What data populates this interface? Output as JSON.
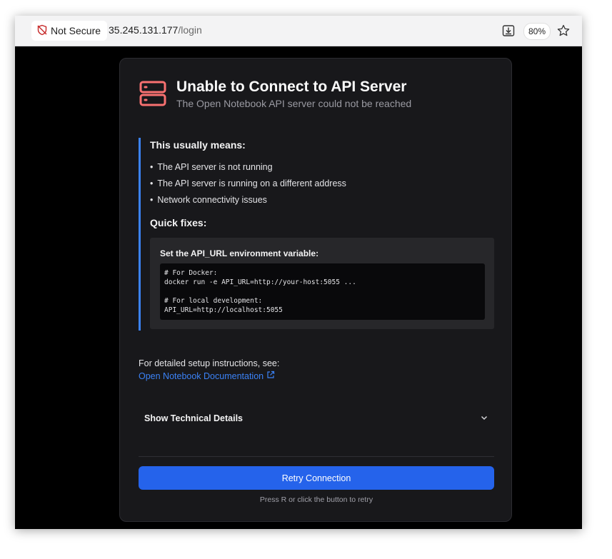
{
  "browser": {
    "security_label": "Not Secure",
    "url_host": "35.245.131.177",
    "url_path": "/login",
    "zoom": "80%"
  },
  "card": {
    "title": "Unable to Connect to API Server",
    "subtitle": "The Open Notebook API server could not be reached",
    "means_heading": "This usually means:",
    "means_items": [
      "The API server is not running",
      "The API server is running on a different address",
      "Network connectivity issues"
    ],
    "fixes_heading": "Quick fixes:",
    "fix_label": "Set the API_URL environment variable:",
    "code_lines": [
      "# For Docker:",
      "docker run -e API_URL=http://your-host:5055 ...",
      "",
      "# For local development:",
      "API_URL=http://localhost:5055"
    ],
    "setup_text": "For detailed setup instructions, see:",
    "docs_link": "Open Notebook Documentation",
    "technical_details": "Show Technical Details",
    "retry_button": "Retry Connection",
    "hint": "Press R or click the button to retry"
  },
  "colors": {
    "accent": "#3b82f6",
    "button": "#2563eb",
    "error_icon": "#f87171",
    "card_bg": "#18181b"
  }
}
